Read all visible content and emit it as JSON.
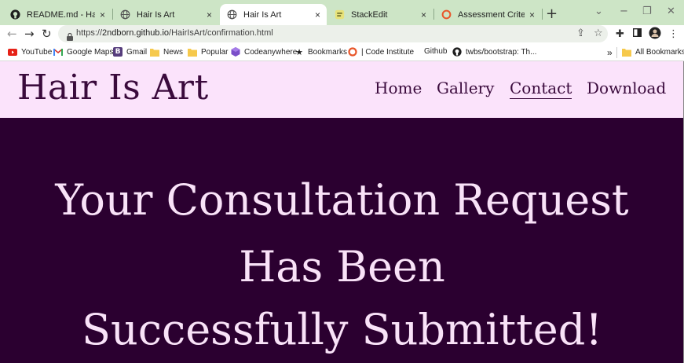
{
  "browser": {
    "tabs": [
      {
        "title": "README.md - HairIsArt |",
        "favicon": "github-icon"
      },
      {
        "title": "Hair Is Art",
        "favicon": "globe-icon"
      },
      {
        "title": "Hair Is Art",
        "favicon": "globe-icon",
        "active": true
      },
      {
        "title": "StackEdit",
        "favicon": "stackedit-icon"
      },
      {
        "title": "Assessment Criteria | Act",
        "favicon": "code-institute-icon"
      }
    ],
    "close_glyph": "×",
    "new_tab_glyph": "+",
    "url_prefix": "https://",
    "url_host": "2ndborn.github.io",
    "url_path": "/HairIsArt/confirmation.html",
    "bookmarks": [
      {
        "label": "YouTube",
        "icon": "youtube-icon"
      },
      {
        "label": "Google Maps",
        "icon": "gmail-icon"
      },
      {
        "label": "Gmail",
        "icon": "bootstrap-icon"
      },
      {
        "label": "News",
        "icon": "folder-icon"
      },
      {
        "label": "Popular",
        "icon": "folder-icon"
      },
      {
        "label": "Codeanywhere",
        "icon": "codeanywhere-icon"
      },
      {
        "label": "Bookmarks",
        "icon": "star-icon"
      },
      {
        "label": "| Code Institute",
        "icon": "code-institute-icon"
      },
      {
        "label": "Github",
        "icon": "none"
      },
      {
        "label": "twbs/bootstrap: Th...",
        "icon": "github-icon"
      }
    ],
    "overflow_label": "»",
    "all_bookmarks_label": "All Bookmarks"
  },
  "site": {
    "logo": "Hair Is Art",
    "nav": [
      "Home",
      "Gallery",
      "Contact",
      "Download"
    ],
    "active_nav": "Contact"
  },
  "confirmation": {
    "lines": [
      "Your Consultation Request",
      "Has Been",
      "Successfully Submitted!"
    ]
  },
  "colors": {
    "tab_strip": "#cde5c6",
    "header_bg": "#fbe3fb",
    "hero_bg": "#2b0030",
    "hero_text": "#f9e2f8",
    "brand_text": "#3a0a3c"
  }
}
